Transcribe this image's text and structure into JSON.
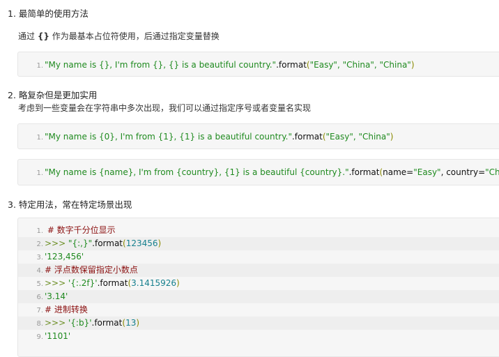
{
  "sections": [
    {
      "heading": "1. 最简单的使用方法",
      "para_pre": "通过 ",
      "para_bold": "{}",
      "para_post": " 作为最基本占位符使用，后通过指定变量替换"
    },
    {
      "heading": "2. 略复杂但是更加实用",
      "para": "考虑到一些变量会在字符串中多次出现，我们可以通过指定序号或者变量名实现"
    },
    {
      "heading": "3. 特定用法，常在特定场景出现"
    }
  ],
  "block1": {
    "n": "1.",
    "s": "\"My name is {}, I'm from {}, {} is a beautiful country.\"",
    "f": ".format",
    "o": "(",
    "a": "\"Easy\", \"China\", \"China\"",
    "c": ")"
  },
  "block2": {
    "n": "1.",
    "s": "\"My name is {0}, I'm from {1}, {1} is a beautiful country.\"",
    "f": ".format",
    "o": "(",
    "a": "\"Easy\", \"China\"",
    "c": ")"
  },
  "block3": {
    "n": "1.",
    "s": "\"My name is {name}, I'm from {country}, {1} is a beautiful {country}.\"",
    "f": ".format",
    "o": "(",
    "k1": "name=",
    "v1": "\"Easy\"",
    "sep": ", ",
    "k2": "country=",
    "v2": "\"China\"",
    "c": ")"
  },
  "block4": [
    {
      "n": "1.",
      "comment": " # 数字千分位显示"
    },
    {
      "n": "2.",
      "prompt": ">>> ",
      "s": "\"{:,}\"",
      "f": ".format",
      "o": "(",
      "num": "123456",
      "c": ")"
    },
    {
      "n": "3.",
      "out": "'123,456'"
    },
    {
      "n": "4.",
      "comment": "# 浮点数保留指定小数点"
    },
    {
      "n": "5.",
      "prompt": ">>> ",
      "s": "'{:.2f}'",
      "f": ".format",
      "o": "(",
      "num": "3.1415926",
      "c": ")"
    },
    {
      "n": "6.",
      "out": "'3.14'"
    },
    {
      "n": "7.",
      "comment": "# 进制转换"
    },
    {
      "n": "8.",
      "prompt": ">>> ",
      "s": "'{:b}'",
      "f": ".format",
      "o": "(",
      "num": "13",
      "c": ")"
    },
    {
      "n": "9.",
      "out": "'1101'"
    }
  ]
}
